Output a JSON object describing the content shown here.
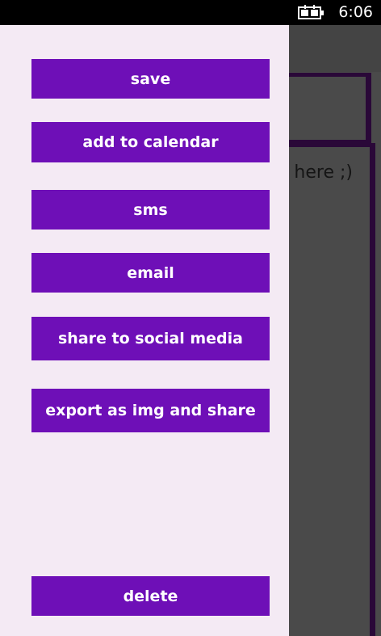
{
  "status_bar": {
    "time": "6:06",
    "battery_icon": "battery-charging-icon"
  },
  "background_app": {
    "editor_text": "s here ;)"
  },
  "drawer": {
    "save_label": "save",
    "add_to_calendar_label": "add to calendar",
    "sms_label": "sms",
    "email_label": "email",
    "share_social_label": "share to social media",
    "export_img_label": "export as img and share",
    "delete_label": "delete"
  },
  "colors": {
    "button": "#6e0fb7",
    "drawer_bg": "#f4eaf4",
    "app_bg": "#4a4a4a",
    "accent_border": "#2a0838"
  }
}
